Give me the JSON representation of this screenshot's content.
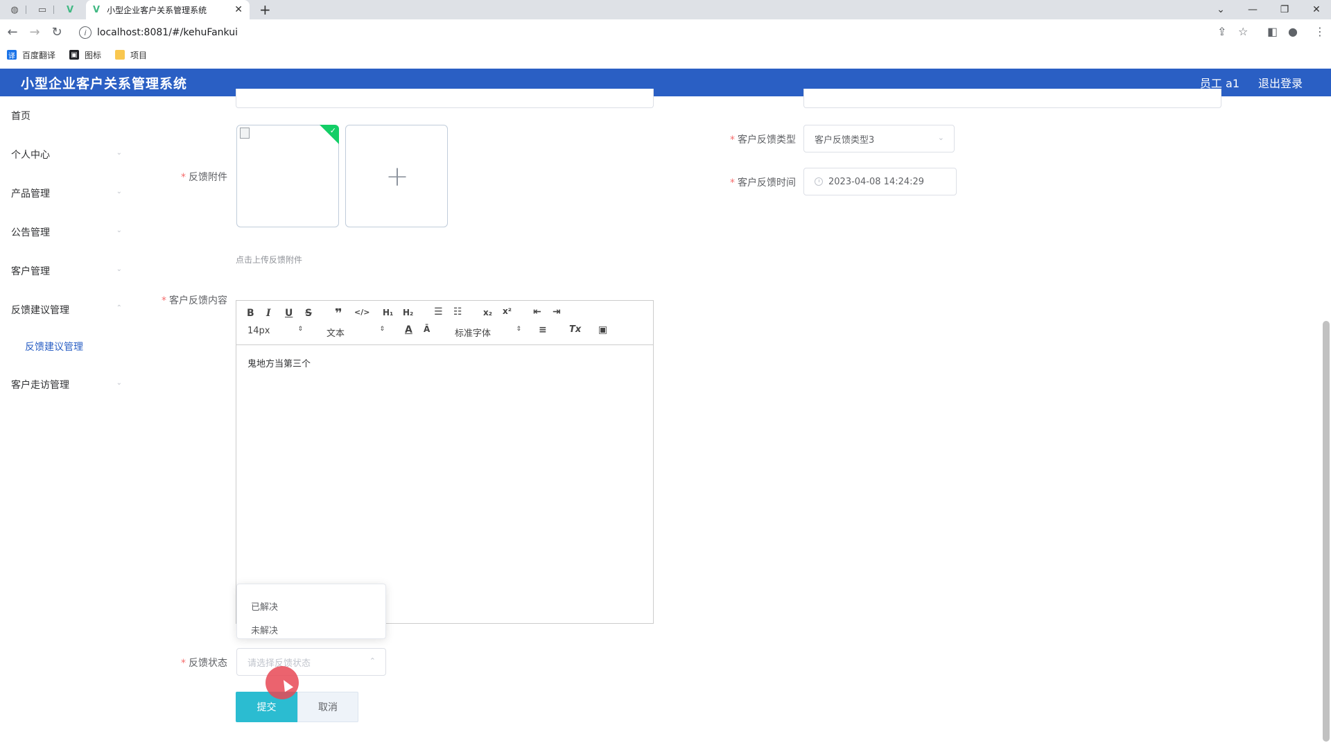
{
  "browser": {
    "tab_title": "小型企业客户关系管理系统",
    "tab_icon": "V",
    "url": "localhost:8081/#/kehuFankui",
    "bookmarks": [
      {
        "label": "百度翻译",
        "icon": "translate-icon",
        "color": "#1a73e8"
      },
      {
        "label": "图标",
        "icon": "image-icon",
        "color": "#202124"
      },
      {
        "label": "项目",
        "icon": "folder-icon",
        "color": "#f9c74f"
      }
    ]
  },
  "header": {
    "title": "小型企业客户关系管理系统",
    "user": "员工 a1",
    "logout": "退出登录",
    "color": "#2a5fc4"
  },
  "sidebar": {
    "items": [
      {
        "label": "首页"
      },
      {
        "label": "个人中心"
      },
      {
        "label": "产品管理"
      },
      {
        "label": "公告管理"
      },
      {
        "label": "客户管理"
      },
      {
        "label": "反馈建议管理"
      },
      {
        "label": "客户走访管理"
      }
    ],
    "sub_item": "反馈建议管理"
  },
  "form": {
    "attachment_label": "反馈附件",
    "attachment_hint": "点击上传反馈附件",
    "type_label": "客户反馈类型",
    "type_value": "客户反馈类型3",
    "time_label": "客户反馈时间",
    "time_value": "2023-04-08 14:24:29",
    "content_label": "客户反馈内容",
    "content_value": "鬼地方当第三个",
    "status_label": "反馈状态",
    "status_placeholder": "请选择反馈状态",
    "status_options": [
      "已解决",
      "未解决"
    ],
    "submit": "提交",
    "cancel": "取消"
  },
  "editor": {
    "font_size": "14px",
    "block_type": "文本",
    "font_family": "标准字体"
  },
  "accent_color": "#2bbcd1"
}
